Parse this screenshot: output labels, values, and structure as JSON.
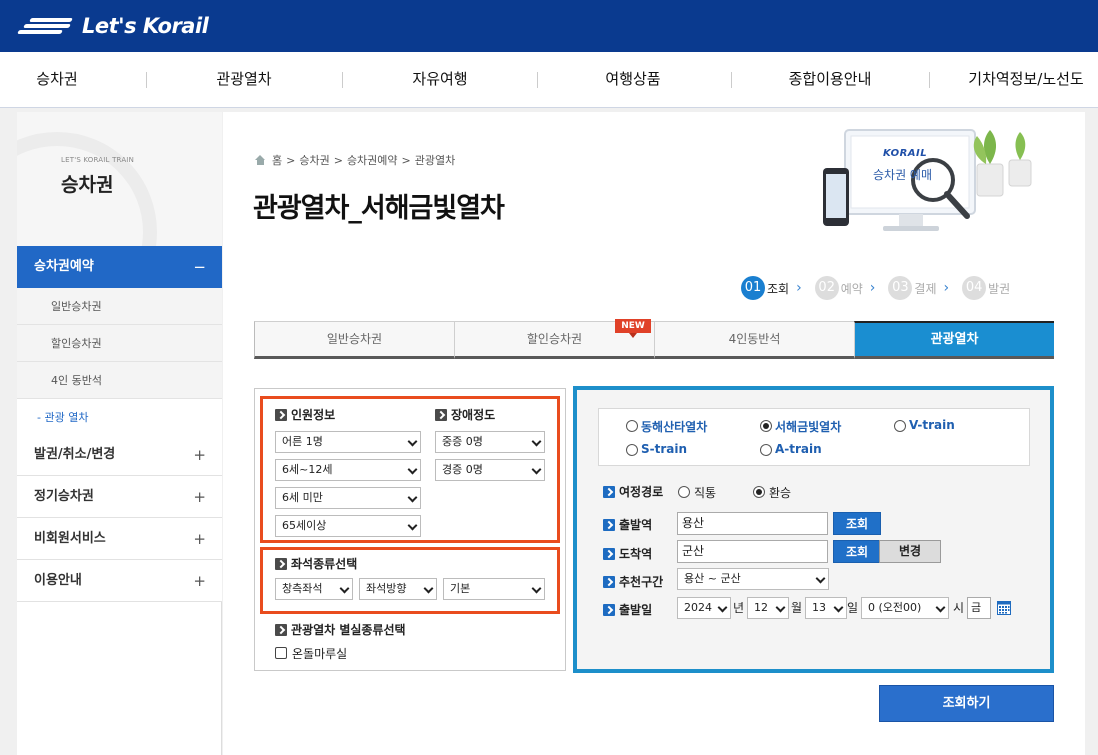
{
  "header": {
    "logo_text": "Let's Korail",
    "bg_color": "#0a3a8f"
  },
  "gnb": [
    "승차권",
    "관광열차",
    "자유여행",
    "여행상품",
    "종합이용안내",
    "기차역정보/노선도"
  ],
  "sidebar": {
    "head_en": "LET'S KORAIL TRAIN",
    "head_title": "승차권",
    "menu_active": "승차권예약",
    "menu_active_toggle": "−",
    "sub": [
      "일반승차권",
      "할인승차권",
      "4인 동반석",
      "관광 열차"
    ],
    "menu_rest": [
      "발권/취소/변경",
      "정기승차권",
      "비회원서비스",
      "이용안내"
    ],
    "toggle_plus": "+"
  },
  "breadcrumb": [
    "홈",
    "승차권",
    "승차권예약",
    "관광열차"
  ],
  "breadcrumb_sep": ">",
  "page_title": "관광열차_서해금빛열차",
  "deco": {
    "brand": "KORAIL",
    "caption": "승차권 예매"
  },
  "steps": [
    {
      "num": "01",
      "label": "조회"
    },
    {
      "num": "02",
      "label": "예약"
    },
    {
      "num": "03",
      "label": "결제"
    },
    {
      "num": "04",
      "label": "발권"
    }
  ],
  "step_arrow": "›",
  "tabs": [
    "일반승차권",
    "할인승차권",
    "4인동반석",
    "관광열차"
  ],
  "tab_badge": "NEW",
  "left_panel": {
    "people_title": "인원정보",
    "people": [
      "어른 1명",
      "6세~12세",
      "6세 미만",
      "65세이상"
    ],
    "disability_title": "장애정도",
    "disability": [
      "중증 0명",
      "경증 0명"
    ],
    "seat_title": "좌석종류선택",
    "seat": [
      "창측좌석",
      "좌석방향",
      "기본"
    ],
    "room_title": "관광열차 별실종류선택",
    "room_option": "온돌마루실"
  },
  "right_panel": {
    "trains": [
      "동해산타열차",
      "서해금빛열차",
      "V-train",
      "S-train",
      "A-train"
    ],
    "selected_train": "서해금빛열차",
    "route_label": "여정경로",
    "route_options": [
      "직통",
      "환승"
    ],
    "route_selected": "환승",
    "dep_label": "출발역",
    "dep_value": "용산",
    "arr_label": "도착역",
    "arr_value": "군산",
    "lookup_btn": "조회",
    "change_btn": "변경",
    "rec_label": "추천구간",
    "rec_value": "용산 ~ 군산",
    "date_label": "출발일",
    "year": "2024",
    "year_unit": "년",
    "month": "12",
    "month_unit": "월",
    "day": "13",
    "day_unit": "일",
    "hour": "0 (오전00)",
    "hour_unit": "시",
    "weekday": "금"
  },
  "search_btn": "조회하기"
}
